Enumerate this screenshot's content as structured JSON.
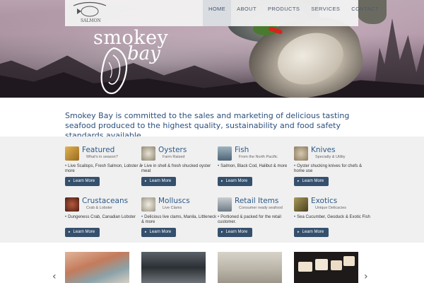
{
  "header": {
    "logo_alt": "SALMON",
    "brand_line1": "smokey",
    "brand_line2": "bay"
  },
  "nav": {
    "items": [
      {
        "label": "HOME",
        "active": true
      },
      {
        "label": "ABOUT",
        "active": false
      },
      {
        "label": "PRODUCTS",
        "active": false
      },
      {
        "label": "SERVICES",
        "active": false
      },
      {
        "label": "CONTACT",
        "active": false
      }
    ]
  },
  "intro": {
    "text": "Smokey Bay is committed to the sales and marketing of delicious tasting seafood produced to the highest quality, sustainability and food safety standards available."
  },
  "categories": [
    {
      "title": "Featured",
      "subtitle": "What's in season?",
      "description": "Live Scallops, Fresh Salmon, Lobster & more",
      "button": "Learn More",
      "icon": "scallops-thumbnail",
      "color": "#c9962e"
    },
    {
      "title": "Oysters",
      "subtitle": "Farm Raised",
      "description": "Live in shell & fresh shucked oyster meat",
      "button": "Learn More",
      "icon": "oysters-thumbnail",
      "color": "#a89f8c"
    },
    {
      "title": "Fish",
      "subtitle": "From the North Pacific",
      "description": "Salmon, Black Cod, Halibut & more",
      "button": "Learn More",
      "icon": "fish-thumbnail",
      "color": "#6a8597"
    },
    {
      "title": "Knives",
      "subtitle": "Specialty & Utility",
      "description": "Oyster shucking knives for chefs & home use",
      "button": "Learn More",
      "icon": "knives-thumbnail",
      "color": "#b5a48c"
    },
    {
      "title": "Crustaceans",
      "subtitle": "Crab & Lobster",
      "description": "Dungeness Crab, Canadian Lobster",
      "button": "Learn More",
      "icon": "crab-thumbnail",
      "color": "#8a3b2a"
    },
    {
      "title": "Molluscs",
      "subtitle": "Live Clams",
      "description": "Delicious live clams, Manila, Littleneck & more",
      "button": "Learn More",
      "icon": "clams-thumbnail",
      "color": "#c9c2b0"
    },
    {
      "title": "Retail Items",
      "subtitle": "Consumer ready seafood",
      "description": "Portioned & packed for the retail customer.",
      "button": "Learn More",
      "icon": "retail-thumbnail",
      "color": "#8e9aa4"
    },
    {
      "title": "Exotics",
      "subtitle": "Unique Delicacies",
      "description": "Sea Cucumber, Geoduck & Exotic Fish",
      "button": "Learn More",
      "icon": "exotics-thumbnail",
      "color": "#7a6a3f"
    }
  ],
  "gallery": {
    "prev": "‹",
    "next": "›",
    "photos": [
      {
        "icon": "salmon-fillet-photo",
        "color": "#c98a6a"
      },
      {
        "icon": "fish-market-photo",
        "color": "#3c444a"
      },
      {
        "icon": "oyster-knives-photo",
        "color": "#b8b2a6"
      },
      {
        "icon": "halibut-portions-photo",
        "color": "#1d1a19"
      }
    ]
  }
}
